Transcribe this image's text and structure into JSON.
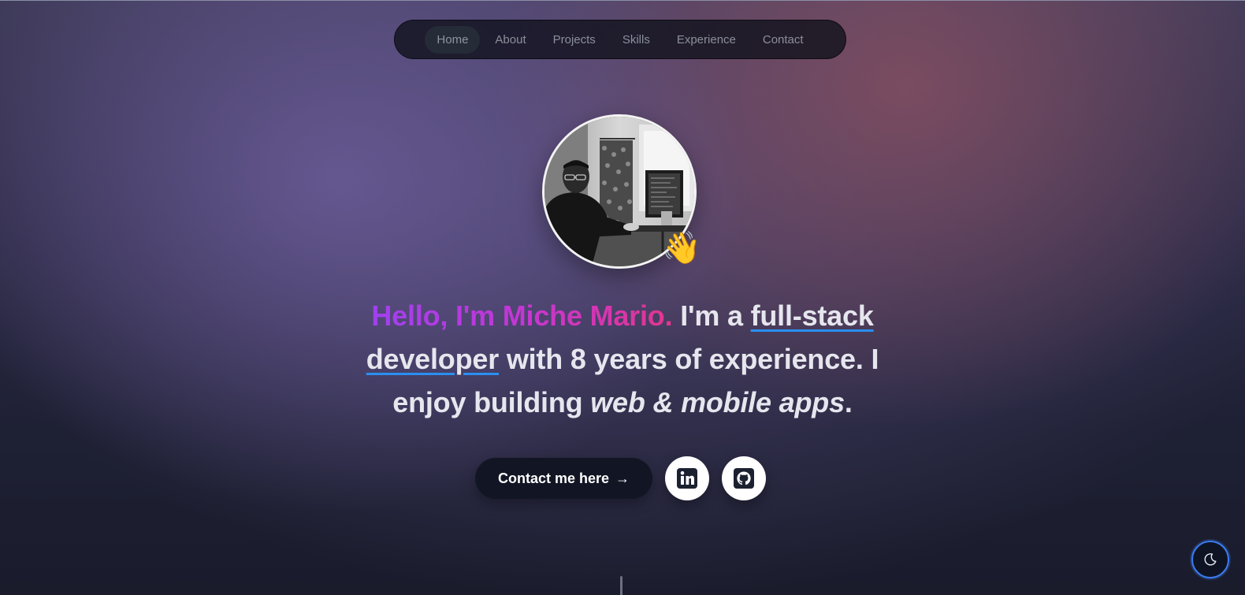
{
  "nav": {
    "items": [
      {
        "label": "Home",
        "active": true
      },
      {
        "label": "About"
      },
      {
        "label": "Projects"
      },
      {
        "label": "Skills"
      },
      {
        "label": "Experience"
      },
      {
        "label": "Contact"
      }
    ]
  },
  "hero": {
    "avatar_icon": "profile-photo",
    "wave_emoji": "👋",
    "headline": {
      "greeting": "Hello, I'm Miche Mario.",
      "part1": " I'm a ",
      "role_a": "full-stack",
      "space": " ",
      "role_b": "developer",
      "part2": " with 8 years of experience. I enjoy building ",
      "italic": "web & mobile apps",
      "end": "."
    },
    "cta_label": "Contact me here",
    "cta_arrow": "→",
    "social": [
      "linkedin-icon",
      "github-icon"
    ]
  },
  "theme_toggle": {
    "icon": "moon-icon"
  },
  "colors": {
    "gradient_start": "#a040f0",
    "gradient_end": "#e2368f",
    "underline": "#2a8ff0",
    "toggle_border": "#3a7bf0"
  }
}
